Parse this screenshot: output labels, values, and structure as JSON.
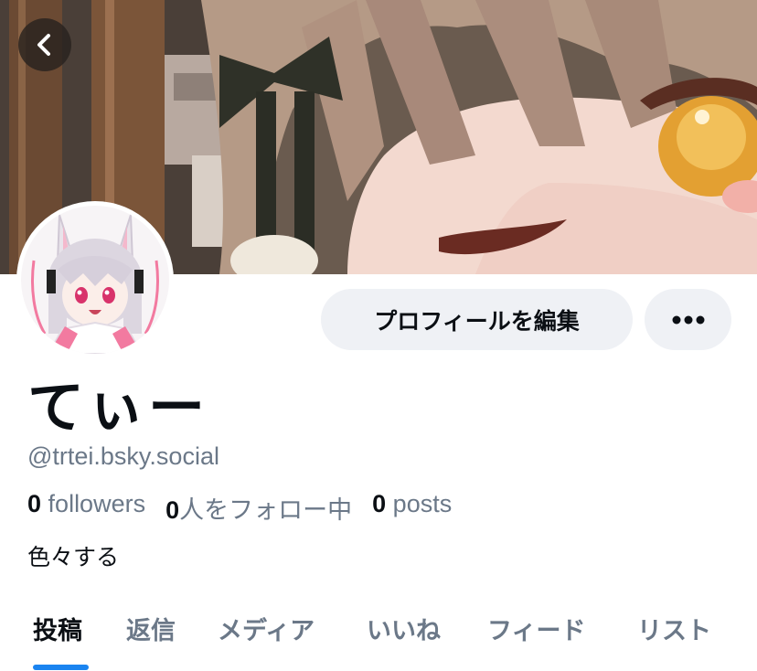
{
  "header": {
    "back_icon": "chevron-left-icon"
  },
  "banner": {
    "alt": "anime character close-up banner"
  },
  "avatar": {
    "alt": "anime style avatar"
  },
  "actions": {
    "edit_profile_label": "プロフィールを編集",
    "more_icon": "ellipsis-icon"
  },
  "profile": {
    "display_name": "てぃー",
    "handle": "@trtei.bsky.social",
    "bio": "色々する"
  },
  "stats": {
    "followers": {
      "count": "0",
      "label": "followers"
    },
    "following": {
      "count": "0",
      "label": "人をフォロー中"
    },
    "posts": {
      "count": "0",
      "label": "posts"
    }
  },
  "tabs": [
    {
      "label": "投稿",
      "active": true
    },
    {
      "label": "返信",
      "active": false
    },
    {
      "label": "メディア",
      "active": false
    },
    {
      "label": "いいね",
      "active": false
    },
    {
      "label": "フィード",
      "active": false
    },
    {
      "label": "リスト",
      "active": false
    }
  ],
  "colors": {
    "accent": "#1a84f0",
    "muted": "#6b7888",
    "button_bg": "#eff1f5"
  }
}
